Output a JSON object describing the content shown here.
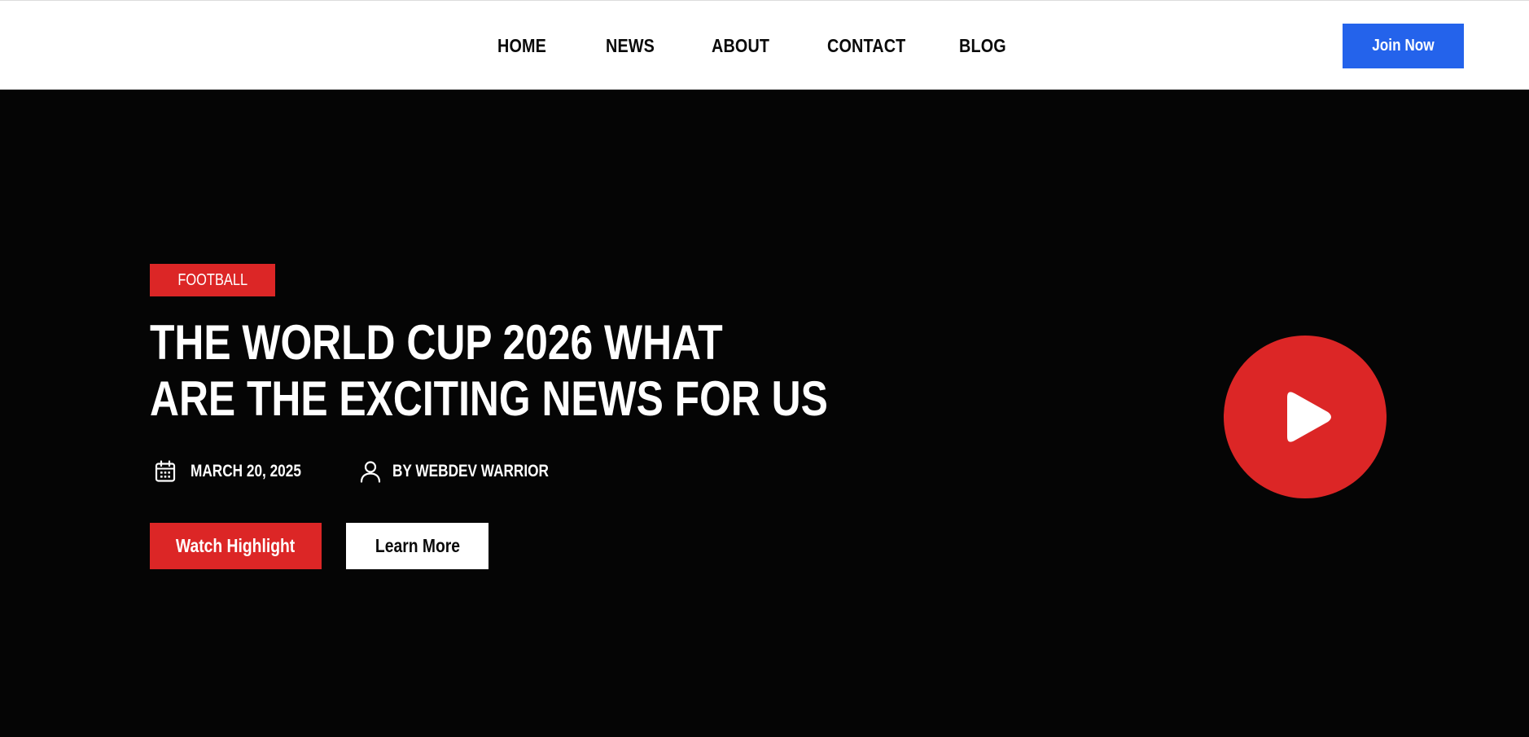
{
  "nav": {
    "links": [
      "HOME",
      "NEWS",
      "ABOUT",
      "CONTACT",
      "BLOG"
    ],
    "join_label": "Join Now"
  },
  "hero": {
    "category": "FOOTBALL",
    "headline_line1": "THE WORLD CUP 2026 WHAT",
    "headline_line2": "ARE THE EXCITING NEWS FOR US",
    "date": "MARCH 20, 2025",
    "author": "BY WEBDEV WARRIOR",
    "watch_label": "Watch Highlight",
    "learn_label": "Learn More"
  },
  "icons": {
    "date": "calendar-icon",
    "author": "user-icon",
    "play": "play-icon"
  },
  "colors": {
    "accent_red": "#dc2626",
    "join_blue": "#2463eb",
    "hero_bg": "#050505",
    "nav_bg": "#ffffff"
  }
}
